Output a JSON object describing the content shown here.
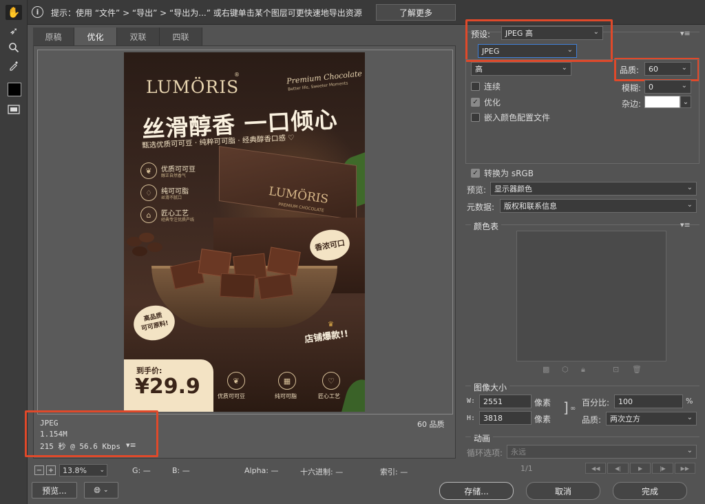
{
  "info": {
    "text": "提示：使用 “文件” > “导出” > “导出为...” 或右键单击某个图层可更快速地导出资源",
    "learn_more": "了解更多"
  },
  "tabs": [
    "原稿",
    "优化",
    "双联",
    "四联"
  ],
  "poster": {
    "brand": "LUMÖRIS",
    "brand_reg": "®",
    "premium": "Premium Chocolate",
    "premium_sub": "Better life, Sweeter Moments",
    "headline": "丝滑醇香 一口倾心",
    "subline": "甄选优质可可豆 · 纯粹可可脂 · 经典醇香口感 ♡",
    "features": [
      {
        "title": "优质可可豆",
        "sub": "醇正自然香气"
      },
      {
        "title": "纯可可脂",
        "sub": "丝滑不腻口"
      },
      {
        "title": "匠心工艺",
        "sub": "经典专注优质产线"
      }
    ],
    "box_brand": "LUMÖRIS",
    "box_sub": "PREMIUM CHOCOLATE",
    "badge_rich": "香浓可口",
    "badge_quality": "高品质\n可可原料!",
    "hot": "店铺爆款!!",
    "price_label": "到手价:",
    "price": "¥29.9",
    "icons": [
      "优质可可豆",
      "纯可可脂",
      "匠心工艺"
    ]
  },
  "status": {
    "format": "JPEG",
    "size": "1.154M",
    "time": "215 秒 @ 56.6 Kbps",
    "menu": "▾≡",
    "quality": "60 品质"
  },
  "bottom": {
    "zoom": "13.8%",
    "g": "G: —",
    "b": "B: —",
    "alpha": "Alpha: —",
    "hex": "十六进制: —",
    "index": "索引: —"
  },
  "buttons": {
    "preview": "预览...",
    "save": "存储...",
    "cancel": "取消",
    "done": "完成"
  },
  "right": {
    "preset_label": "预设:",
    "preset_value": "JPEG 高",
    "format_value": "JPEG",
    "quality_level": "高",
    "quality_label": "品质:",
    "quality_value": "60",
    "progressive": "连续",
    "blur_label": "模糊:",
    "blur_value": "0",
    "optimized": "优化",
    "matte_label": "杂边:",
    "embed_profile": "嵌入颜色配置文件",
    "convert_srgb": "转换为 sRGB",
    "preview_label": "预览:",
    "preview_value": "显示器颜色",
    "metadata_label": "元数据:",
    "metadata_value": "版权和联系信息",
    "color_table": "颜色表",
    "image_size": "图像大小",
    "w_label": "W:",
    "w_value": "2551",
    "h_label": "H:",
    "h_value": "3818",
    "pixels": "像素",
    "percent_label": "百分比:",
    "percent_value": "100",
    "percent_unit": "%",
    "resample_label": "品质:",
    "resample_value": "两次立方",
    "animation": "动画",
    "loop_label": "循环选项:",
    "loop_value": "永远",
    "frame": "1/1"
  },
  "colors": {
    "highlight": "#e0492a",
    "price_bg": "#f3e3c4"
  }
}
